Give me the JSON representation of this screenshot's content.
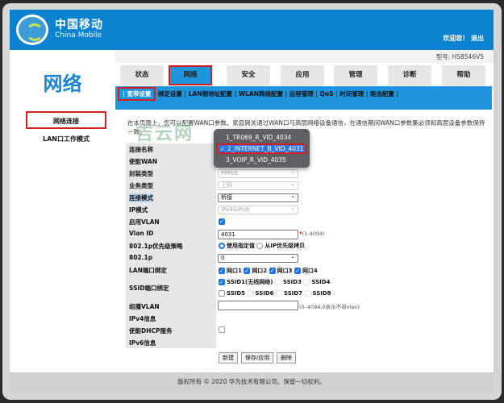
{
  "header": {
    "brand_cn": "中国移动",
    "brand_en": "China Mobile",
    "welcome": "欢迎您！",
    "logout": "退出"
  },
  "sidebar": {
    "title": "网络",
    "items": [
      {
        "label": "网络连接",
        "selected": true
      },
      {
        "label": "LAN口工作模式",
        "selected": false
      }
    ]
  },
  "model": "型号: HS8546V5",
  "tabs": [
    {
      "label": "状态"
    },
    {
      "label": "网络",
      "selected": true
    },
    {
      "label": "安全"
    },
    {
      "label": "应用"
    },
    {
      "label": "管理"
    },
    {
      "label": "诊断"
    },
    {
      "label": "帮助"
    }
  ],
  "subnav": [
    {
      "label": "宽带设置",
      "selected": true
    },
    {
      "label": "绑定设置"
    },
    {
      "label": "LAN侧地址配置"
    },
    {
      "label": "WLAN网络配置"
    },
    {
      "label": "远程管理"
    },
    {
      "label": "QoS"
    },
    {
      "label": "时间管理"
    },
    {
      "label": "路由配置"
    }
  ],
  "description": "在本页面上，您可以配置WAN口参数。家庭网关通过WAN口与高层网络设备通信，在通信期间WAN口参数集必须和高层设备参数保持一致。",
  "watermark": "吉云网",
  "form": {
    "labels": [
      "连接名称",
      "使能WAN",
      "封装类型",
      "业务类型",
      "连接模式",
      "IP模式",
      "启用VLAN",
      "Vlan ID",
      "802.1p优先级策略",
      "802.1p",
      "LAN端口绑定",
      "SSID端口绑定",
      "组播VLAN",
      "IPv4信息",
      "使能DHCP服务",
      "IPv6信息"
    ],
    "encap": "PPPoE",
    "service": "上网",
    "mode": "桥接",
    "ip_mode": "IPv4&IPv6",
    "vlan_enabled": true,
    "vlan_id": "4031",
    "vlan_required": "*",
    "vlan_hint": "(1-4094)",
    "priority_opts": [
      {
        "label": "使用指定值",
        "checked": true
      },
      {
        "label": "从IP优先级拷贝",
        "checked": false
      }
    ],
    "p8021": "0",
    "lan_ports": [
      {
        "label": "网口1",
        "checked": true
      },
      {
        "label": "网口2",
        "checked": true
      },
      {
        "label": "网口3",
        "checked": true
      },
      {
        "label": "网口4",
        "checked": true
      }
    ],
    "ssids": [
      {
        "label": "SSID1(无线网络)",
        "checked": true
      },
      {
        "label": "SSID3",
        "checked": false,
        "disabled": true
      },
      {
        "label": "SSID4",
        "checked": false,
        "disabled": true
      },
      {
        "label": "SSID5",
        "checked": false
      },
      {
        "label": "SSID6",
        "checked": false,
        "disabled": true
      },
      {
        "label": "SSID7",
        "checked": false,
        "disabled": true
      },
      {
        "label": "SSID8",
        "checked": false,
        "disabled": true
      }
    ],
    "multicast_vlan": "",
    "multicast_hint": "(0–4094,0表示不带vlan)",
    "dhcp": false
  },
  "buttons": {
    "new": "新建",
    "save": "保存/应用",
    "delete": "删除"
  },
  "dropdown": {
    "options": [
      "1_TR069_R_VID_4034",
      "2_INTERNET_B_VID_4031",
      "3_VOIP_R_VID_4035"
    ],
    "selected_index": 1,
    "check": "✓"
  },
  "footer": "版权所有 © 2020 华为技术有限公司。保留一切权利。"
}
